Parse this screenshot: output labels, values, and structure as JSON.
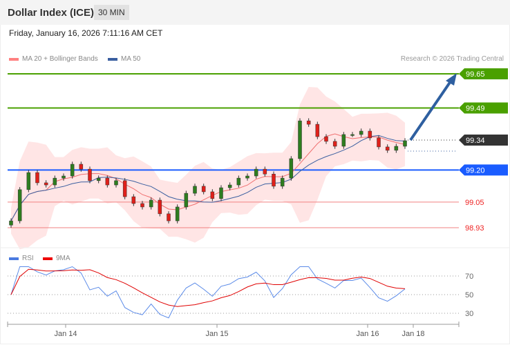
{
  "header": {
    "title": "Dollar Index (ICE)",
    "timeframe": "30 MIN",
    "date": "Friday, January 16, 2026 7:11:16 AM CET"
  },
  "legend": {
    "ma20": "MA 20 + Bollinger Bands",
    "ma50": "MA 50",
    "copyright": "Research © 2026 Trading Central",
    "rsi": "RSI",
    "rsi_ma": "9MA"
  },
  "colors": {
    "up": "#2e7d1f",
    "down": "#e0201a",
    "band": "#ffdede",
    "ma20": "#f07070",
    "ma50": "#3a5fa0",
    "green": "#4aa000",
    "blue": "#1a5cff",
    "dark": "#333333",
    "red": "#ee2222"
  },
  "chart_data": {
    "type": "candlestick",
    "ylim": [
      98.89,
      99.68
    ],
    "levels": [
      {
        "value": "99.65",
        "kind": "resistance"
      },
      {
        "value": "99.49",
        "kind": "resistance"
      },
      {
        "value": "99.34",
        "kind": "last"
      },
      {
        "value": "99.20",
        "kind": "pivot"
      },
      {
        "value": "99.05",
        "kind": "support"
      },
      {
        "value": "98.93",
        "kind": "support"
      }
    ],
    "closes": [
      98.962,
      99.108,
      99.188,
      99.14,
      99.13,
      99.162,
      99.172,
      99.227,
      99.204,
      99.15,
      99.162,
      99.13,
      99.15,
      99.075,
      99.043,
      99.027,
      99.059,
      98.995,
      98.962,
      99.027,
      99.091,
      99.124,
      99.098,
      99.066,
      99.117,
      99.13,
      99.162,
      99.172,
      99.204,
      99.181,
      99.124,
      99.162,
      99.253,
      99.43,
      99.414,
      99.356,
      99.334,
      99.311,
      99.366,
      99.366,
      99.382,
      99.35,
      99.308,
      99.292,
      99.311,
      99.337
    ],
    "x_ticks": [
      "Jan 14",
      "Jan 15",
      "Jan 16",
      "Jan 18"
    ],
    "rsi_ticks": [
      "70",
      "50",
      "30"
    ]
  }
}
